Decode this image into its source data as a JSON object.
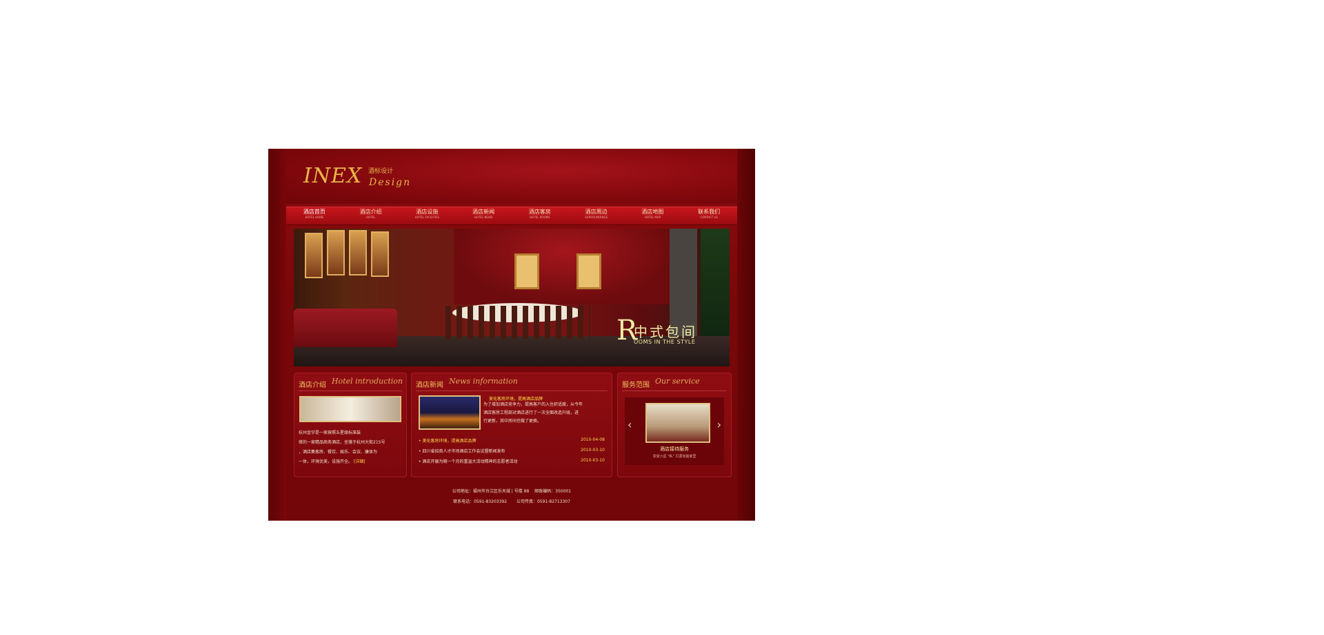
{
  "logo": {
    "text": "INEX",
    "sub": "酒标设计",
    "design": "Design"
  },
  "nav": [
    {
      "cn": "酒店首页",
      "en": "HOTEL HOME"
    },
    {
      "cn": "酒店介绍",
      "en": "HOTEL"
    },
    {
      "cn": "酒店设施",
      "en": "HOTEL FACILITIES"
    },
    {
      "cn": "酒店新闻",
      "en": "HOTEL NEWS"
    },
    {
      "cn": "酒店客房",
      "en": "HOTEL ROOMS"
    },
    {
      "cn": "酒店周边",
      "en": "SURROUNDINGS"
    },
    {
      "cn": "酒店地图",
      "en": "HOTEL MAP"
    },
    {
      "cn": "联系我们",
      "en": "CONTACT US"
    }
  ],
  "banner": {
    "letter": "R",
    "cn": "中式包间",
    "en": "OOMS IN THE STYLE"
  },
  "intro": {
    "title_cn": "酒店介绍",
    "title_en": "Hotel introduction",
    "lines": [
      "  杭州金宇是一家按照五星级标准装",
      "修的一家精品商务酒店，坐落于杭州大街215号",
      "，酒店集客房、餐饮、娱乐、会议、康体为",
      "一体，环境优美，设施齐全。"
    ],
    "more": "[详细]"
  },
  "news": {
    "title_cn": "酒店新闻",
    "title_en": "News information",
    "headline": "美化客房环境，提高酒店品牌",
    "summary": [
      "    为了增加酒店竞争力，提高客户的入住舒适度，从今年",
      "酒店客房工程部对酒店进行了一次全面改造升级，进",
      "行更新，其中房间也做了更换。"
    ],
    "items": [
      {
        "text": "美化客房环境，提高酒店品牌",
        "date": "2010-04-08",
        "highlight": true
      },
      {
        "text": "四川省招商人才市场酒店工作会议暨新闻发布",
        "date": "2010-03-10",
        "highlight": false
      },
      {
        "text": "酒店开展为期一个月的重温大活动精神的志愿者活动",
        "date": "2010-03-10",
        "highlight": false
      }
    ]
  },
  "service": {
    "title_cn": "服务范围",
    "title_en": "Our service",
    "prev": "‹",
    "next": "›",
    "name": "酒店接待服务",
    "desc": "享受六星 \"私\" 贝源克装家里"
  },
  "footer": {
    "line1": "公司地址：福州市台江区乐天城 | 号楼 88　 邮政编码：350001",
    "line2": "联系电话：0591-83203392　　 公司传真：0591-82713307"
  }
}
